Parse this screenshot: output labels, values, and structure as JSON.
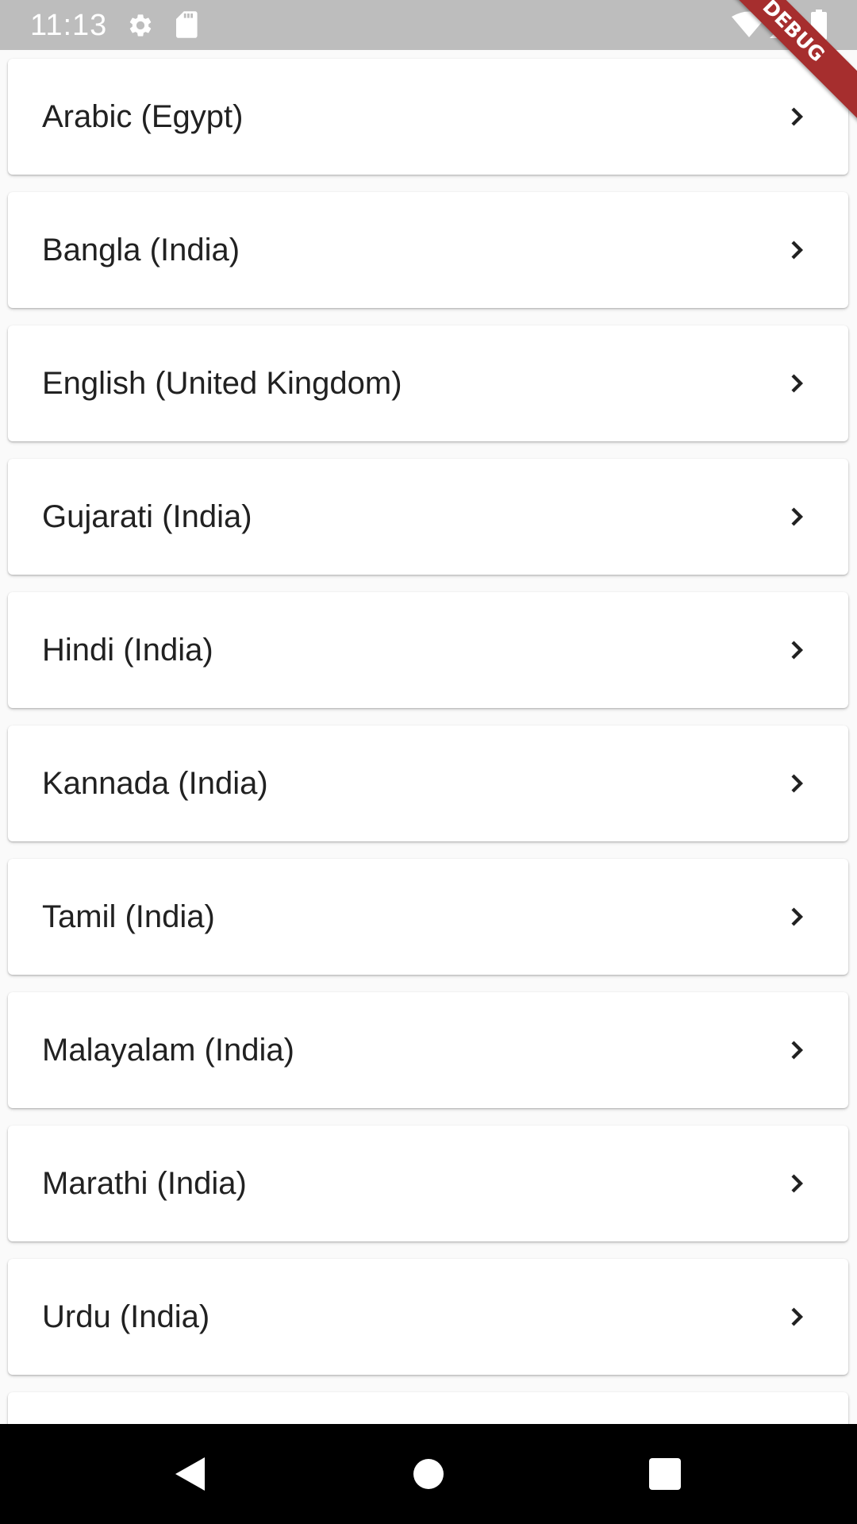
{
  "status_bar": {
    "time": "11:13",
    "icons": [
      "gear-icon",
      "sd-card-icon",
      "wifi-icon",
      "signal-icon",
      "battery-icon"
    ],
    "background": "#bdbdbd"
  },
  "debug_banner": {
    "label": "DEBUG",
    "color": "#a62e2e"
  },
  "languages": {
    "items": [
      {
        "label": "Arabic (Egypt)"
      },
      {
        "label": "Bangla (India)"
      },
      {
        "label": "English (United Kingdom)"
      },
      {
        "label": "Gujarati (India)"
      },
      {
        "label": "Hindi (India)"
      },
      {
        "label": "Kannada (India)"
      },
      {
        "label": "Tamil (India)"
      },
      {
        "label": "Malayalam (India)"
      },
      {
        "label": "Marathi (India)"
      },
      {
        "label": "Urdu (India)"
      }
    ],
    "trailing_icon": "chevron-right-icon"
  },
  "nav_bar": {
    "buttons": [
      "back-icon",
      "home-icon",
      "recents-icon"
    ],
    "background": "#000000"
  }
}
